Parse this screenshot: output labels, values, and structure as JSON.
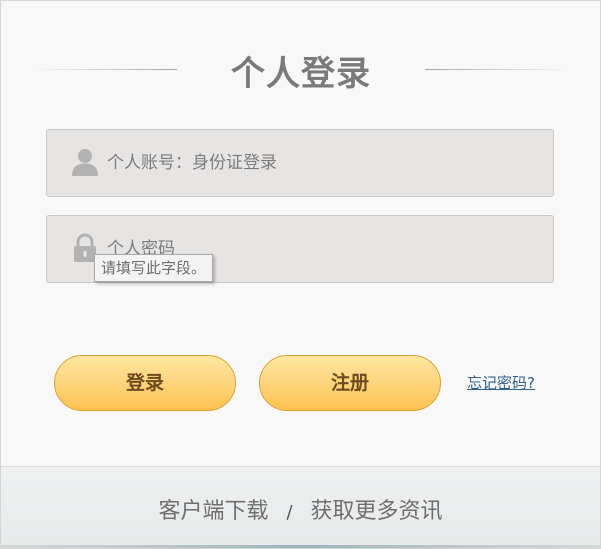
{
  "title": "个人登录",
  "account": {
    "placeholder": "个人账号：身份证登录",
    "icon": "user-icon"
  },
  "password": {
    "placeholder": "个人密码",
    "icon": "lock-icon"
  },
  "validation_tooltip": "请填写此字段。",
  "buttons": {
    "login": "登录",
    "register": "注册"
  },
  "forgot_link": "忘记密码?",
  "footer": {
    "client_download": "客户端下载",
    "separator": "/",
    "more_info": "获取更多资讯"
  },
  "colors": {
    "button_gradient_top": "#ffe7a2",
    "button_gradient_bottom": "#ffc24e",
    "link": "#2f5f8a",
    "title": "#7a7a7a"
  }
}
